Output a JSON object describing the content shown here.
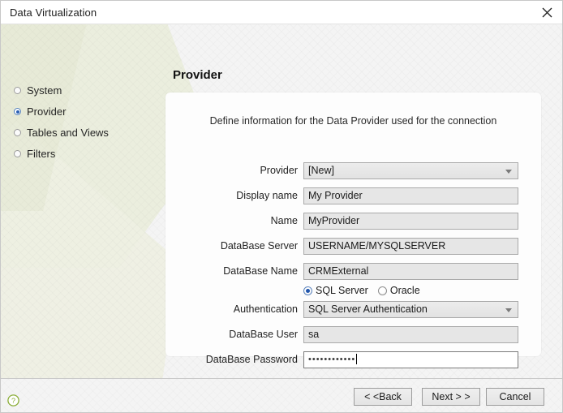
{
  "window": {
    "title": "Data Virtualization",
    "close_icon": "close-icon"
  },
  "sidebar": {
    "items": [
      {
        "label": "System",
        "selected": false
      },
      {
        "label": "Provider",
        "selected": true
      },
      {
        "label": "Tables and Views",
        "selected": false
      },
      {
        "label": "Filters",
        "selected": false
      }
    ]
  },
  "main": {
    "page_title": "Provider",
    "description": "Define information for the Data Provider used for the connection",
    "fields": [
      {
        "label": "Provider",
        "type": "select",
        "value": "[New]"
      },
      {
        "label": "Display name",
        "type": "text",
        "value": "My Provider"
      },
      {
        "label": "Name",
        "type": "text",
        "value": "MyProvider"
      },
      {
        "label": "DataBase Server",
        "type": "text",
        "value": "USERNAME/MYSQLSERVER"
      },
      {
        "label": "DataBase Name",
        "type": "text",
        "value": "CRMExternal"
      },
      {
        "label": "Authentication",
        "type": "select",
        "value": "SQL Server Authentication"
      },
      {
        "label": "DataBase User",
        "type": "text",
        "value": "sa"
      },
      {
        "label": "DataBase Password",
        "type": "password",
        "value": "••••••••••••",
        "focused": true
      }
    ],
    "database_type": {
      "options": [
        {
          "label": "SQL Server",
          "checked": true
        },
        {
          "label": "Oracle",
          "checked": false
        }
      ]
    }
  },
  "footer": {
    "help_icon": "help-icon",
    "help_color": "#7fa829",
    "buttons": {
      "back": "< <Back",
      "next": "Next > >",
      "cancel": "Cancel"
    }
  },
  "colors": {
    "accent_radio": "#2b5fb4",
    "background": "#f4f4f4",
    "panel": "#fdfdfd",
    "watermark": "#e9ecd9"
  }
}
